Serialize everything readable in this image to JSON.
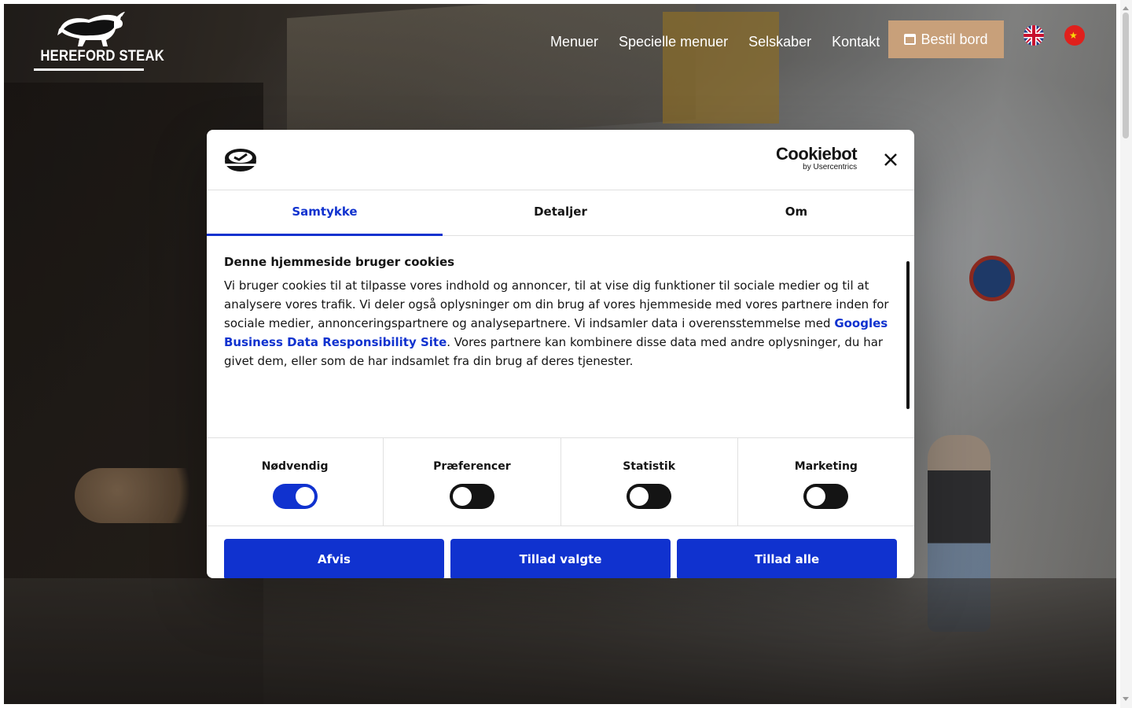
{
  "brand": {
    "logo_text": "HEREFORD STEAK"
  },
  "nav": {
    "items": [
      "Menuer",
      "Specielle menuer",
      "Selskaber",
      "Kontakt"
    ],
    "book_label": "Bestil bord"
  },
  "languages": [
    "English",
    "中文"
  ],
  "cookie_dialog": {
    "provider": "Cookiebot",
    "provider_sub": "by Usercentrics",
    "tabs": [
      "Samtykke",
      "Detaljer",
      "Om"
    ],
    "active_tab": "Samtykke",
    "title": "Denne hjemmeside bruger cookies",
    "text_part1": "Vi bruger cookies til at tilpasse vores indhold og annoncer, til at vise dig funktioner til sociale medier og til at analysere vores trafik. Vi deler også oplysninger om din brug af vores hjemmeside med vores partnere inden for sociale medier, annonceringspartnere og analysepartnere. Vi indsamler data i overensstemmelse med ",
    "link_text": "Googles Business Data Responsibility Site",
    "text_part2": ". Vores partnere kan kombinere disse data med andre oplysninger, du har givet dem, eller som de har indsamlet fra din brug af deres tjenester.",
    "categories": [
      {
        "label": "Nødvendig",
        "enabled": true
      },
      {
        "label": "Præferencer",
        "enabled": false
      },
      {
        "label": "Statistik",
        "enabled": false
      },
      {
        "label": "Marketing",
        "enabled": false
      }
    ],
    "buttons": {
      "deny": "Afvis",
      "allow_selected": "Tillad valgte",
      "allow_all": "Tillad alle"
    }
  },
  "colors": {
    "accent": "#1032cf",
    "book_button": "#c8a07a",
    "text": "#141414"
  }
}
